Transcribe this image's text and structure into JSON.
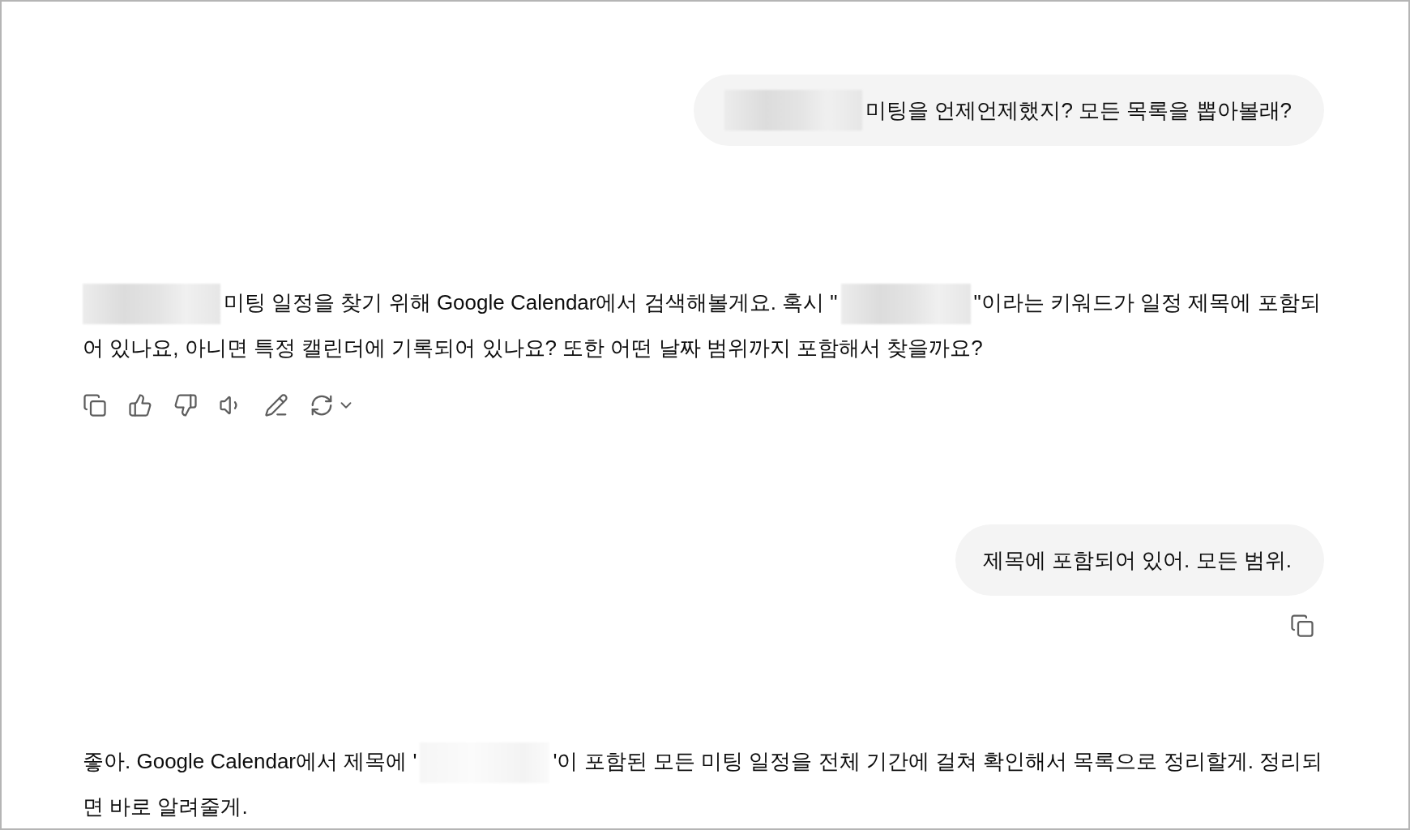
{
  "messages": [
    {
      "kind": "user",
      "segments": [
        {
          "kind": "redacted"
        },
        {
          "kind": "text",
          "text": "미팅을 언제언제했지? 모든 목록을 뽑아볼래?"
        }
      ]
    },
    {
      "kind": "assistant",
      "segments": [
        {
          "kind": "redacted"
        },
        {
          "kind": "text",
          "text": "미팅 일정을 찾기 위해 Google Calendar에서 검색해볼게요. 혹시 \""
        },
        {
          "kind": "redacted"
        },
        {
          "kind": "text",
          "text": "\"이라는 키워드가 일정 제목에 포함되어 있나요, 아니면 특정 캘린더에 기록되어 있나요? 또한 어떤 날짜 범위까지 포함해서 찾을까요?"
        }
      ],
      "actions": true
    },
    {
      "kind": "user",
      "segments": [
        {
          "kind": "text",
          "text": "제목에 포함되어 있어. 모든 범위."
        }
      ],
      "copy": true
    },
    {
      "kind": "assistant",
      "segments": [
        {
          "kind": "text",
          "text": "좋아. Google Calendar에서 제목에 '"
        },
        {
          "kind": "redacted",
          "faint": true
        },
        {
          "kind": "text",
          "text": "'이 포함된 모든 미팅 일정을 전체 기간에 걸쳐 확인해서 목록으로 정리할게. 정리되면 바로 알려줄게."
        }
      ]
    }
  ]
}
